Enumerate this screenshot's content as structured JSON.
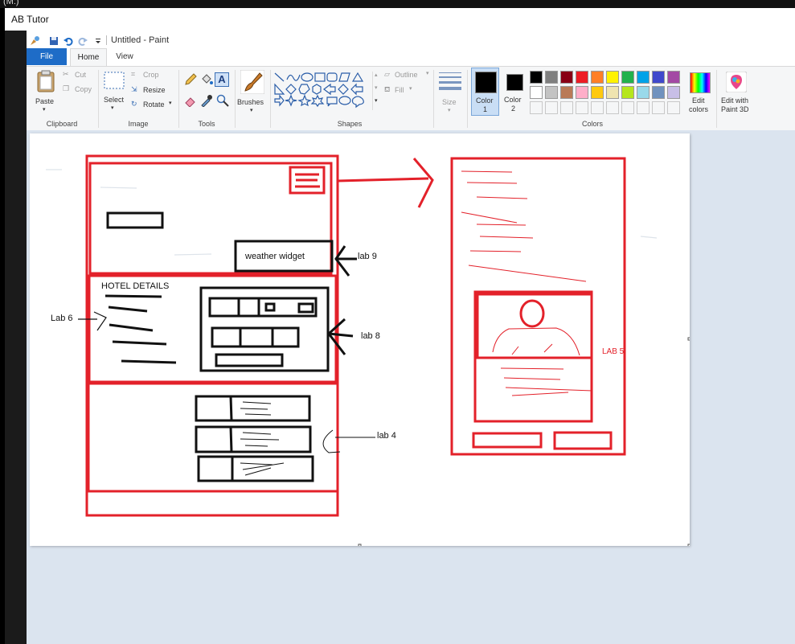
{
  "desktop": {
    "corner_label": "(M:)"
  },
  "outer_window": {
    "title": "AB Tutor"
  },
  "paint": {
    "title": "Untitled - Paint",
    "tabs": {
      "file": "File",
      "home": "Home",
      "view": "View"
    },
    "clipboard": {
      "paste": "Paste",
      "cut": "Cut",
      "copy": "Copy",
      "group": "Clipboard"
    },
    "image": {
      "select": "Select",
      "crop": "Crop",
      "resize": "Resize",
      "rotate": "Rotate",
      "group": "Image"
    },
    "tools": {
      "group": "Tools"
    },
    "brushes": {
      "label": "Brushes"
    },
    "shapes": {
      "outline": "Outline",
      "fill": "Fill",
      "group": "Shapes"
    },
    "size": {
      "label": "Size"
    },
    "colors": {
      "color1_label": "Color",
      "color1_num": "1",
      "color2_label": "Color",
      "color2_num": "2",
      "edit_colors_1": "Edit",
      "edit_colors_2": "colors",
      "edit_3d_1": "Edit with",
      "edit_3d_2": "Paint 3D",
      "group": "Colors",
      "palette_row1": [
        "#000000",
        "#7f7f7f",
        "#880015",
        "#ed1c24",
        "#ff7f27",
        "#fff200",
        "#22b14c",
        "#00a2e8",
        "#3f48cc",
        "#a349a4"
      ],
      "palette_row2": [
        "#ffffff",
        "#c3c3c3",
        "#b97a57",
        "#ffaec9",
        "#ffc90e",
        "#efe4b0",
        "#b5e61d",
        "#99d9ea",
        "#7092be",
        "#c8bfe7"
      ]
    }
  },
  "drawing": {
    "weather_widget": "weather widget",
    "lab9": "lab 9",
    "hotel_details": "HOTEL DETAILS",
    "lab6": "Lab 6",
    "lab8": "lab 8",
    "lab4": "lab 4",
    "lab5": "LAB 5"
  }
}
